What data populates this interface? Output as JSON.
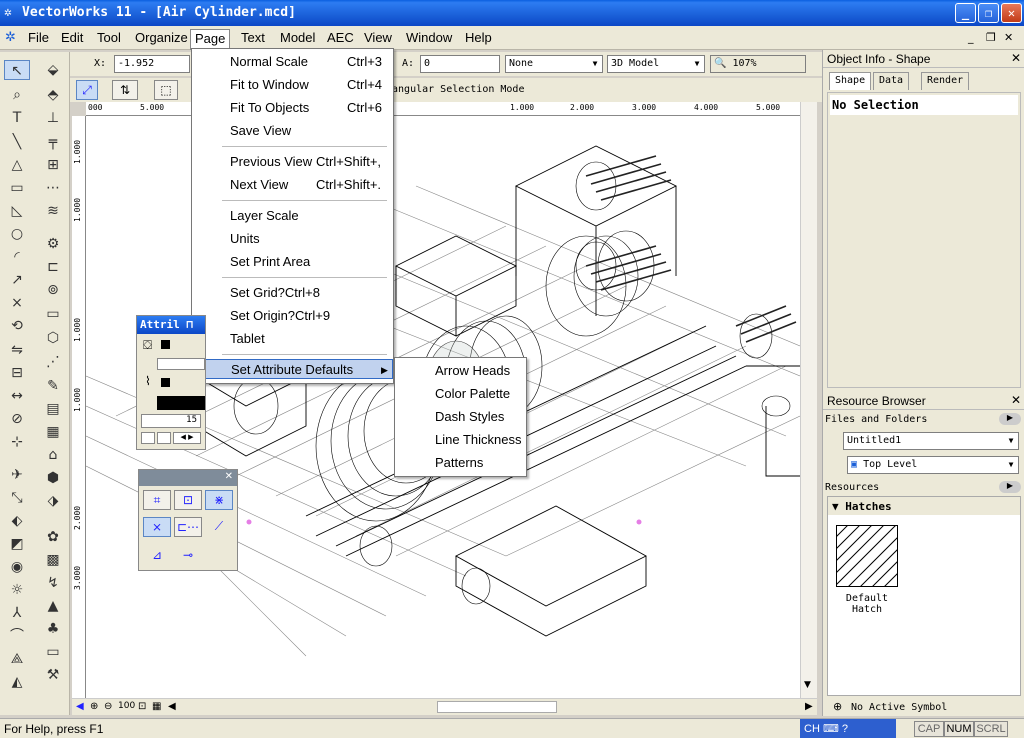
{
  "window": {
    "title": "VectorWorks 11 - [Air Cylinder.mcd]",
    "controls": {
      "minimize": "_",
      "restore": "❐",
      "close": "✕"
    }
  },
  "menubar": [
    "File",
    "Edit",
    "Tool",
    "Organize",
    "Page",
    "Text",
    "Model",
    "AEC",
    "View",
    "Window",
    "Help"
  ],
  "doc_controls": {
    "minimize": "_",
    "restore": "❐",
    "close": "✕"
  },
  "data_bar": {
    "x_label": "X:",
    "x_value": "-1.952",
    "a_label": "A:",
    "a_value": "0",
    "class_value": "None",
    "view_value": "3D Model",
    "zoom_value": "107%"
  },
  "mode_bar": {
    "text": "Rectangular Selection Mode",
    "visible_text": "tangular Selection Mode"
  },
  "ruler": {
    "top_ticks": [
      "000",
      "5.000",
      "1.000",
      "2.000",
      "3.000",
      "4.000",
      "5.000"
    ],
    "left_ticks": [
      "1.000",
      "1.000",
      "1.000",
      "1.000",
      "2.000",
      "3.000"
    ]
  },
  "page_menu": {
    "items": [
      {
        "label": "Normal Scale",
        "shortcut": "Ctrl+3"
      },
      {
        "label": "Fit to Window",
        "shortcut": "Ctrl+4"
      },
      {
        "label": "Fit To Objects",
        "shortcut": "Ctrl+6"
      },
      {
        "label": "Save View",
        "shortcut": ""
      },
      {
        "label": "Previous View",
        "shortcut": "Ctrl+Shift+,"
      },
      {
        "label": "Next View",
        "shortcut": "Ctrl+Shift+."
      },
      {
        "label": "Layer Scale",
        "shortcut": ""
      },
      {
        "label": "Units",
        "shortcut": ""
      },
      {
        "label": "Set Print Area",
        "shortcut": ""
      },
      {
        "label": "Set Grid?Ctrl+8",
        "shortcut": ""
      },
      {
        "label": "Set Origin?Ctrl+9",
        "shortcut": ""
      },
      {
        "label": "Tablet",
        "shortcut": ""
      },
      {
        "label": "Set Attribute Defaults",
        "shortcut": ""
      }
    ]
  },
  "attr_submenu": [
    "Arrow Heads",
    "Color Palette",
    "Dash Styles",
    "Line Thickness",
    "Patterns"
  ],
  "attributes_palette": {
    "title": "Attril",
    "line_weight": "15"
  },
  "object_info": {
    "title": "Object Info - Shape",
    "tabs": [
      "Shape",
      "Data",
      "Render"
    ],
    "selection": "No Selection"
  },
  "resource_browser": {
    "title": "Resource Browser",
    "files_label": "Files and Folders",
    "file_value": "Untitled1",
    "level_value": "Top Level",
    "resources_label": "Resources",
    "group_label": "Hatches",
    "resource_name": "Default Hatch",
    "symbol_status": "No Active Symbol"
  },
  "hscroll_zoom": "100",
  "status": {
    "help": "For Help, press F1",
    "ime": "CH",
    "cap": "CAP",
    "num": "NUM",
    "scrl": "SCRL"
  }
}
